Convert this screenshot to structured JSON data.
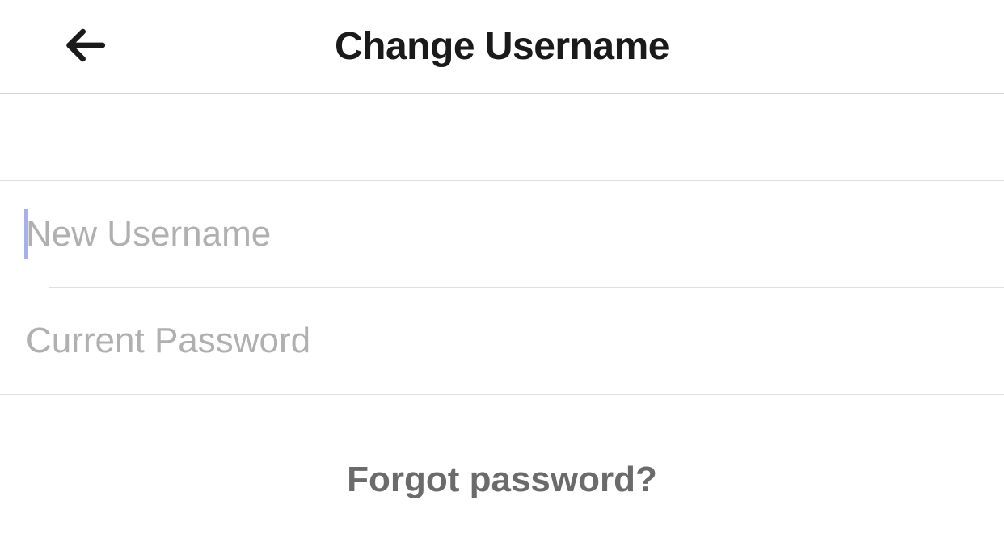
{
  "header": {
    "title": "Change Username"
  },
  "form": {
    "username": {
      "placeholder": "New Username",
      "value": ""
    },
    "password": {
      "placeholder": "Current Password",
      "value": ""
    }
  },
  "links": {
    "forgot": "Forgot password?"
  }
}
